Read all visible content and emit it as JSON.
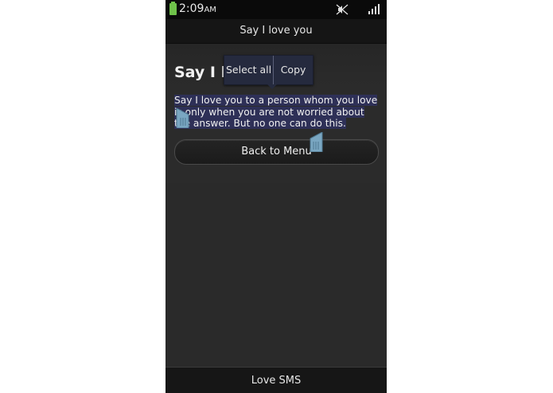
{
  "status_bar": {
    "time": "2:09",
    "ampm": "AM",
    "icons": [
      "battery-icon",
      "mute-icon",
      "signal-icon"
    ]
  },
  "title_bar": {
    "title": "Say I love you"
  },
  "content": {
    "heading": "Say I lo",
    "body_text": "Say I love you to a person whom you love is only when you are not worried about the answer. But no one can do this.",
    "button_label": "Back to Menu"
  },
  "popup": {
    "select_all_label": "Select all",
    "copy_label": "Copy"
  },
  "bottom_bar": {
    "label": "Love SMS"
  },
  "colors": {
    "battery": "#6fc24a",
    "selection_highlight": "#2e3057",
    "handle": "#6c9ab5",
    "popup_background": "#252a3e"
  }
}
